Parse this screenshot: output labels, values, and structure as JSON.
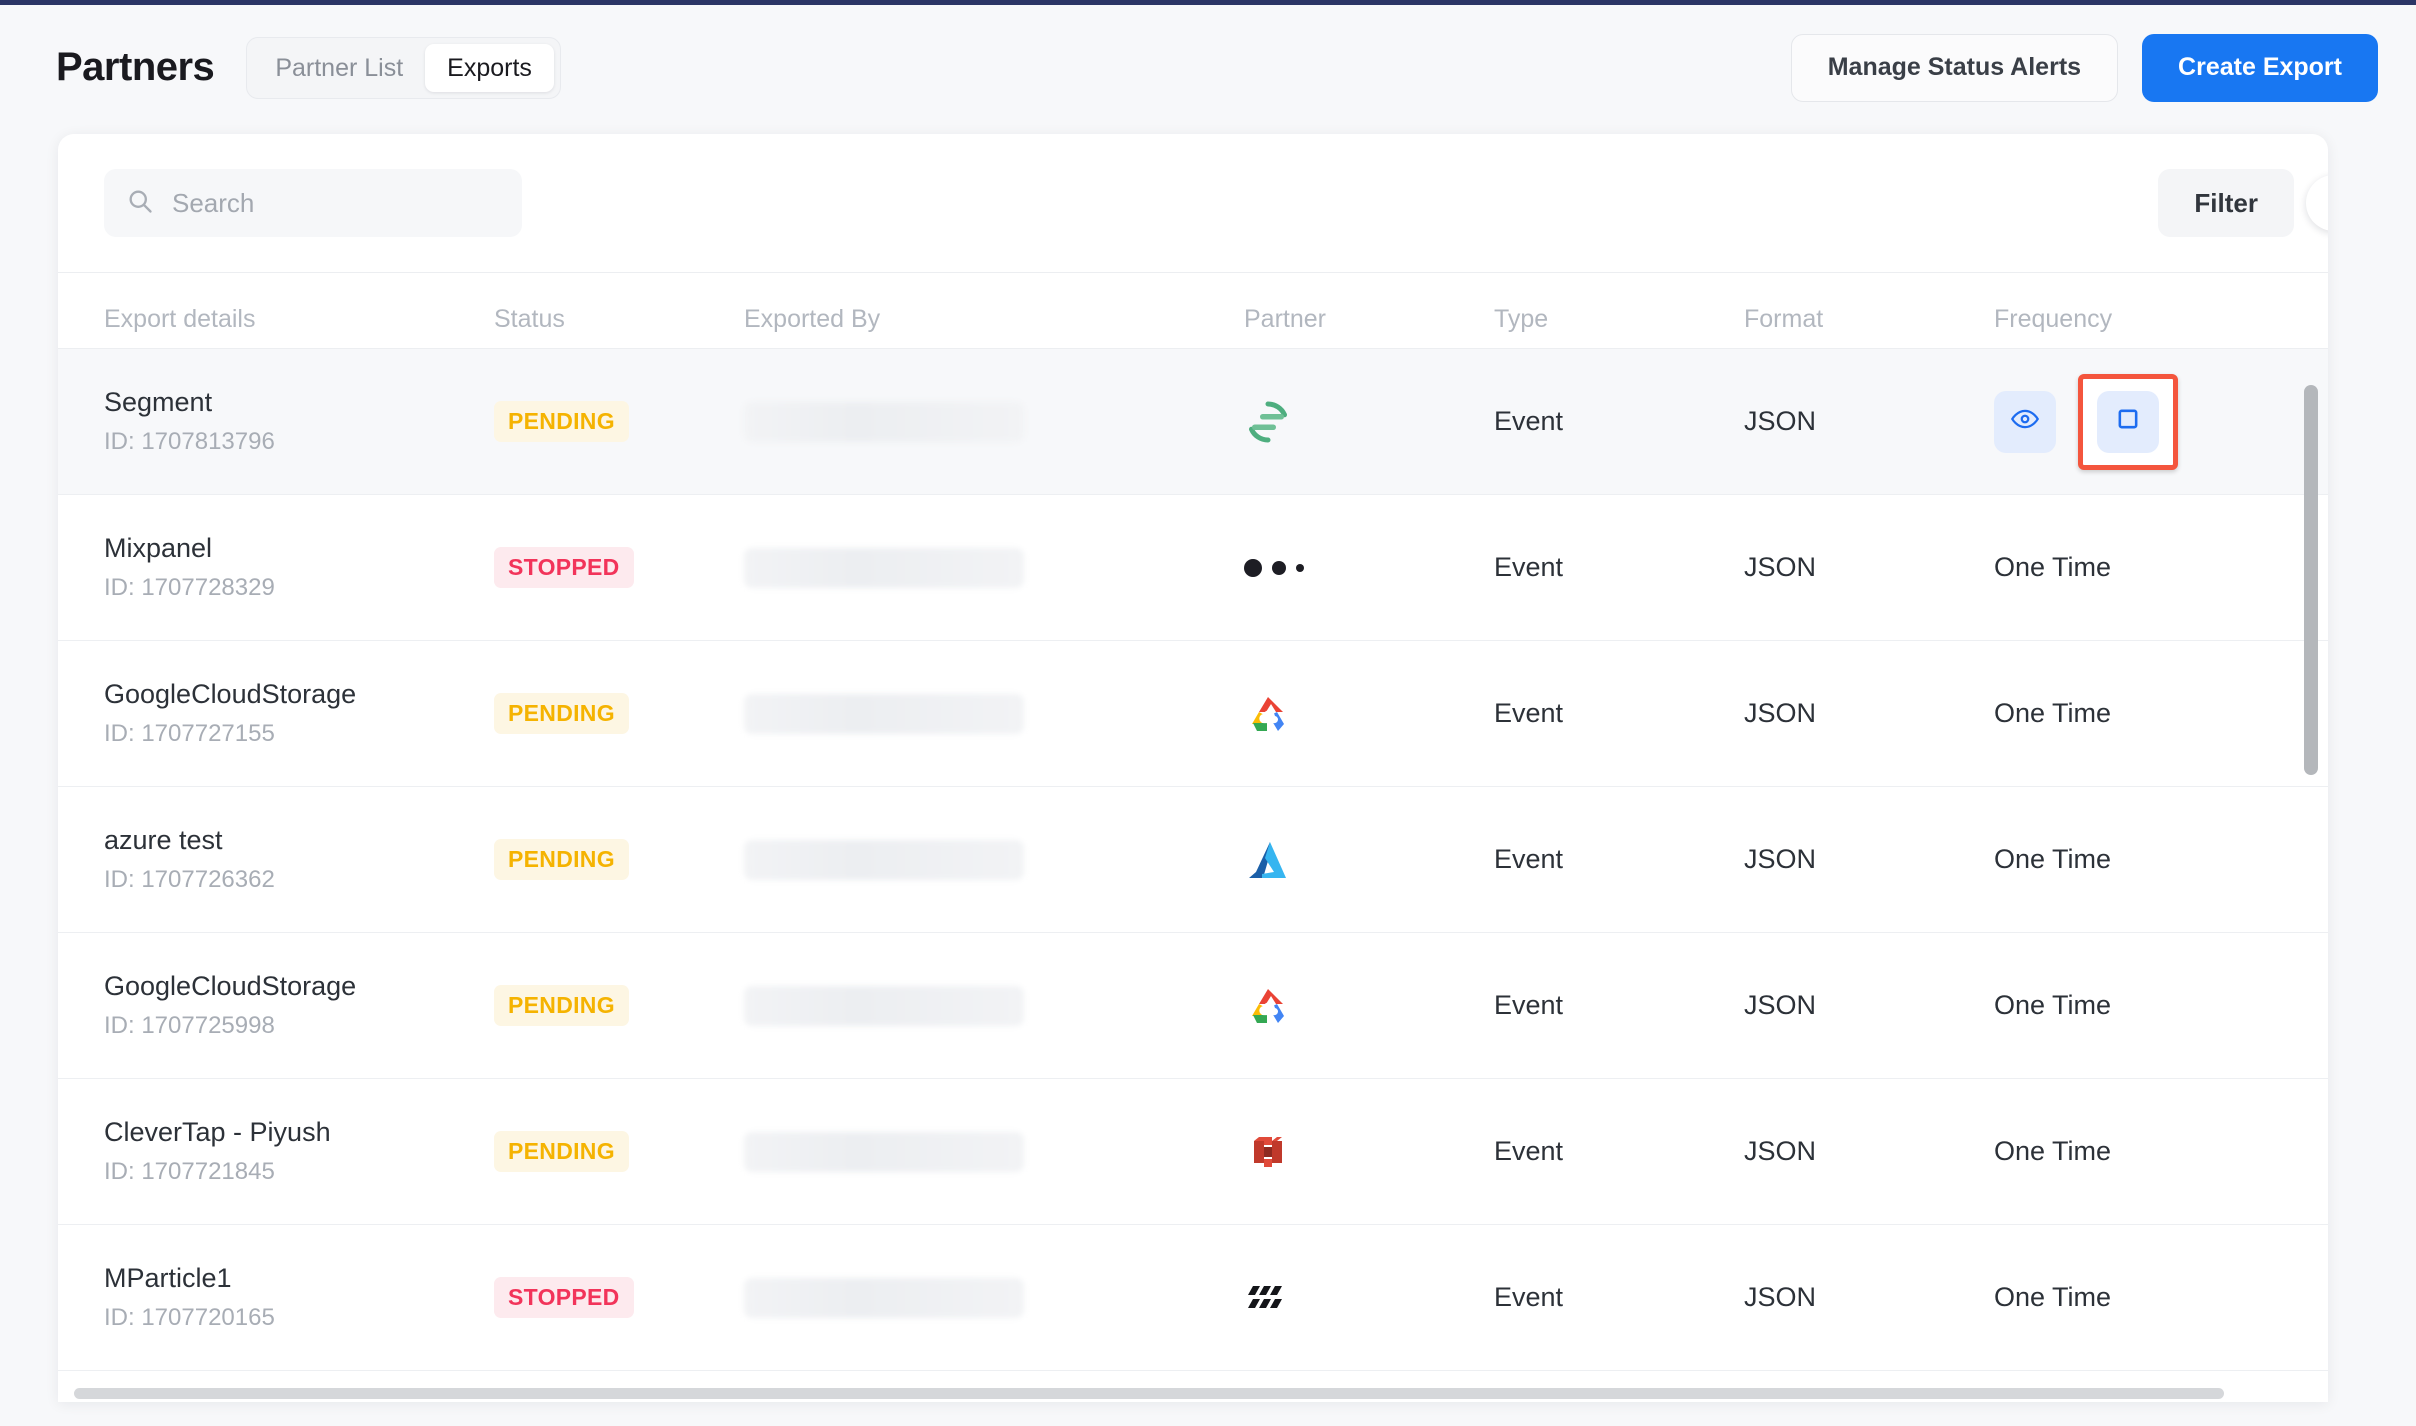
{
  "header": {
    "title": "Partners",
    "tabs": [
      {
        "label": "Partner List",
        "active": false
      },
      {
        "label": "Exports",
        "active": true
      }
    ],
    "manage_alerts_label": "Manage Status Alerts",
    "create_export_label": "Create Export",
    "primary_color": "#1877f2"
  },
  "toolbar": {
    "search_placeholder": "Search",
    "search_value": "",
    "filter_label": "Filter",
    "collapse_icon": "chevron-left-icon"
  },
  "table": {
    "columns": [
      "Export details",
      "Status",
      "Exported By",
      "Partner",
      "Type",
      "Format",
      "Frequency"
    ],
    "rows": [
      {
        "name": "Segment",
        "id": "ID: 1707813796",
        "status": "PENDING",
        "status_kind": "pending",
        "exported_by": "",
        "partner_logo": "segment-logo",
        "type": "Event",
        "format": "JSON",
        "frequency": "",
        "actions": [
          "view-icon",
          "stop-icon"
        ],
        "highlighted": true
      },
      {
        "name": "Mixpanel",
        "id": "ID: 1707728329",
        "status": "STOPPED",
        "status_kind": "stopped",
        "exported_by": "",
        "partner_logo": "mixpanel-logo",
        "type": "Event",
        "format": "JSON",
        "frequency": "One Time",
        "actions": [],
        "highlighted": false
      },
      {
        "name": "GoogleCloudStorage",
        "id": "ID: 1707727155",
        "status": "PENDING",
        "status_kind": "pending",
        "exported_by": "",
        "partner_logo": "google-cloud-logo",
        "type": "Event",
        "format": "JSON",
        "frequency": "One Time",
        "actions": [],
        "highlighted": false
      },
      {
        "name": "azure test",
        "id": "ID: 1707726362",
        "status": "PENDING",
        "status_kind": "pending",
        "exported_by": "",
        "partner_logo": "azure-logo",
        "type": "Event",
        "format": "JSON",
        "frequency": "One Time",
        "actions": [],
        "highlighted": false
      },
      {
        "name": "GoogleCloudStorage",
        "id": "ID: 1707725998",
        "status": "PENDING",
        "status_kind": "pending",
        "exported_by": "",
        "partner_logo": "google-cloud-logo",
        "type": "Event",
        "format": "JSON",
        "frequency": "One Time",
        "actions": [],
        "highlighted": false
      },
      {
        "name": "CleverTap - Piyush",
        "id": "ID: 1707721845",
        "status": "PENDING",
        "status_kind": "pending",
        "exported_by": "",
        "partner_logo": "clevertap-logo",
        "type": "Event",
        "format": "JSON",
        "frequency": "One Time",
        "actions": [],
        "highlighted": false
      },
      {
        "name": "MParticle1",
        "id": "ID: 1707720165",
        "status": "STOPPED",
        "status_kind": "stopped",
        "exported_by": "",
        "partner_logo": "mparticle-logo",
        "type": "Event",
        "format": "JSON",
        "frequency": "One Time",
        "actions": [],
        "highlighted": false
      }
    ]
  },
  "colors": {
    "pending_text": "#f5b301",
    "pending_bg": "#fdf6e3",
    "stopped_text": "#f2345a",
    "stopped_bg": "#fdeaee",
    "action_bg": "#e3ecfd",
    "action_icon": "#1d6cf0",
    "highlight_border": "#f4553d"
  }
}
